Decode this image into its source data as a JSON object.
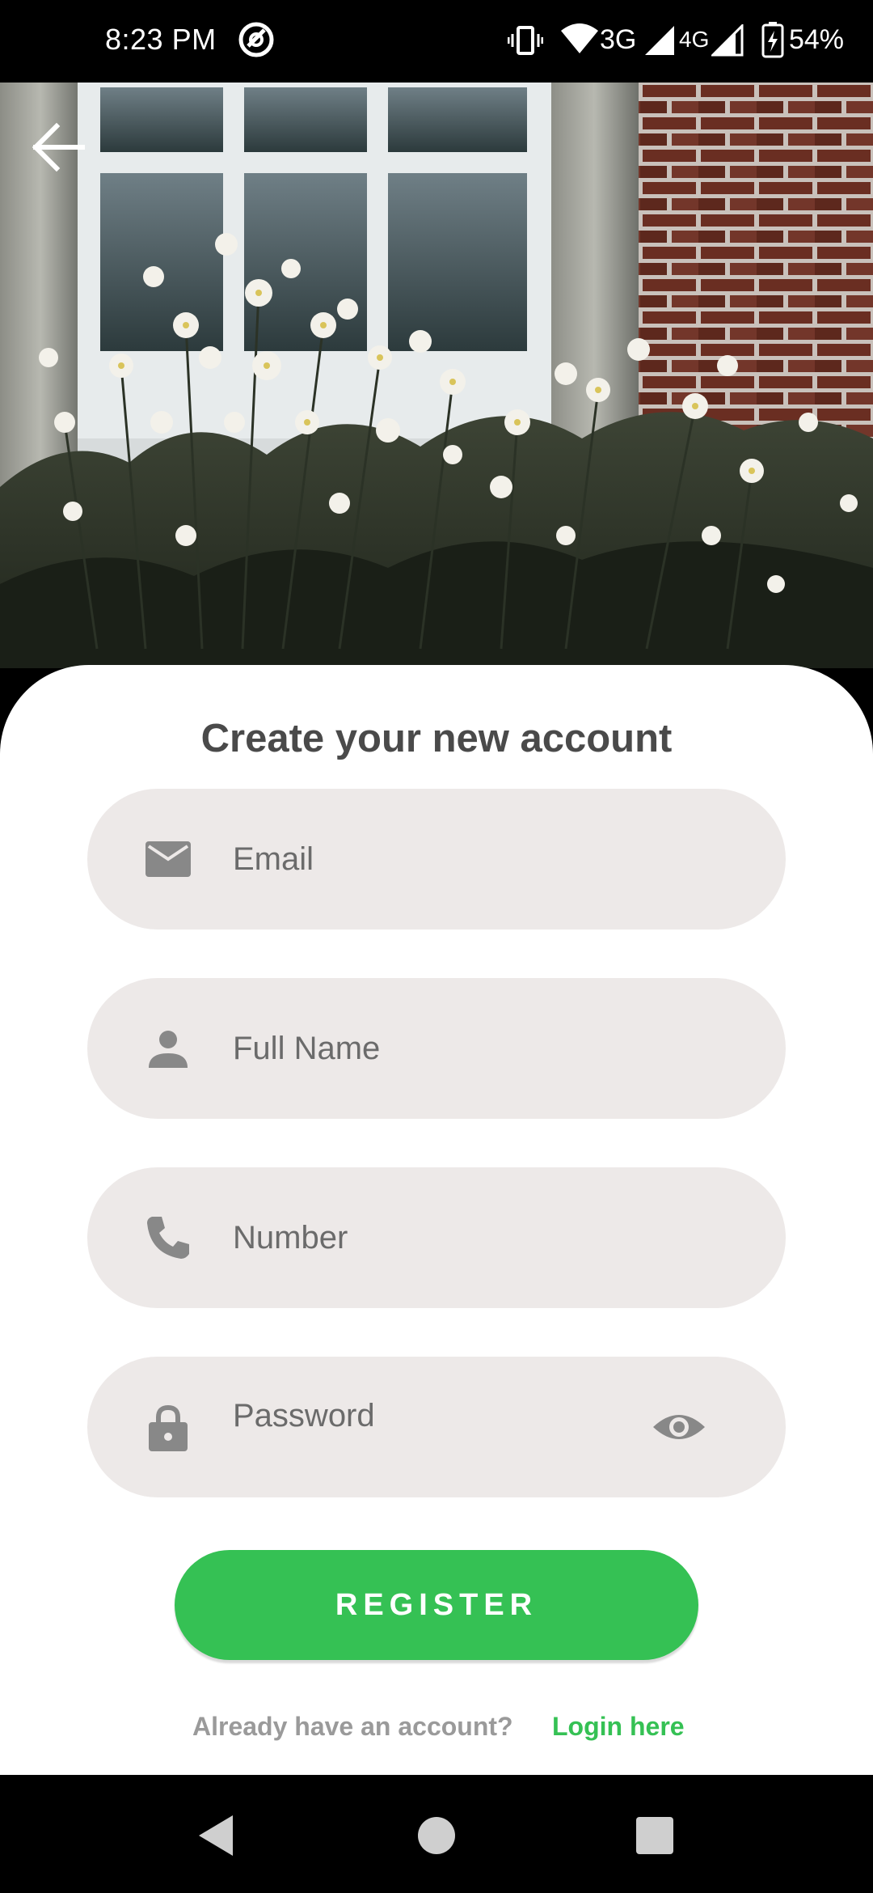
{
  "status_bar": {
    "time": "8:23 PM",
    "network_3g": "3G",
    "network_4g": "4G",
    "battery": "54%"
  },
  "header": {
    "back_icon": "arrow-left-icon"
  },
  "form": {
    "title": "Create your new account",
    "email": {
      "placeholder": "Email",
      "icon": "mail-icon"
    },
    "full_name": {
      "placeholder": "Full Name",
      "icon": "person-icon"
    },
    "number": {
      "placeholder": "Number",
      "icon": "phone-icon"
    },
    "password": {
      "placeholder": "Password",
      "icon": "lock-icon",
      "toggle_icon": "eye-icon"
    },
    "register_label": "REGISTER",
    "already_text": "Already have an account?",
    "login_link": "Login here"
  },
  "colors": {
    "accent": "#35c154",
    "field_bg": "#ede9e8",
    "title": "#4a4a4a"
  },
  "nav": {
    "back": "triangle-back-icon",
    "home": "circle-home-icon",
    "recents": "square-recents-icon"
  }
}
